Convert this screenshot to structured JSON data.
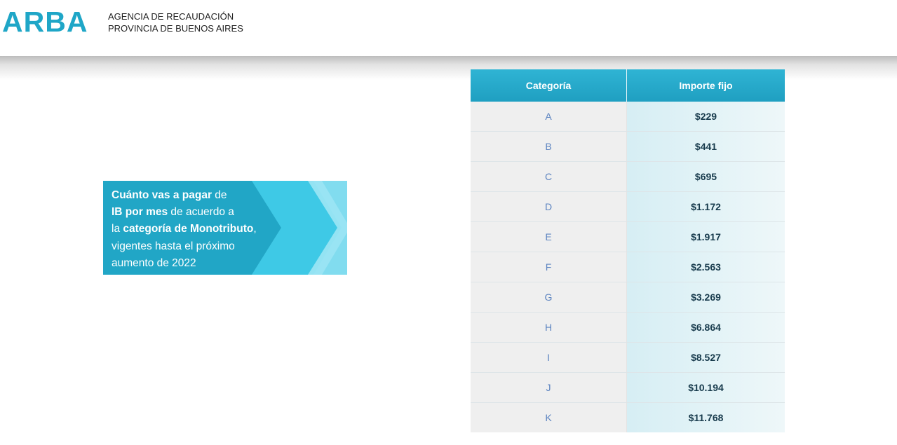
{
  "header": {
    "logo_text": "ARBA",
    "agency_line1": "AGENCIA DE RECAUDACIÓN",
    "agency_line2": "PROVINCIA DE BUENOS AIRES"
  },
  "banner": {
    "p1_bold": "Cuánto vas a pagar",
    "p1_rest": " de",
    "p2_bold": "IB por mes",
    "p2_rest": " de acuerdo a",
    "p3_start": "la ",
    "p3_bold": "categoría de Monotributo",
    "p3_rest": ",",
    "p4": "vigentes hasta el próximo",
    "p5": "aumento de 2022"
  },
  "table": {
    "headers": [
      "Categoría",
      "Importe fijo"
    ],
    "rows": [
      {
        "categoria": "A",
        "importe": "$229"
      },
      {
        "categoria": "B",
        "importe": "$441"
      },
      {
        "categoria": "C",
        "importe": "$695"
      },
      {
        "categoria": "D",
        "importe": "$1.172"
      },
      {
        "categoria": "E",
        "importe": "$1.917"
      },
      {
        "categoria": "F",
        "importe": "$2.563"
      },
      {
        "categoria": "G",
        "importe": "$3.269"
      },
      {
        "categoria": "H",
        "importe": "$6.864"
      },
      {
        "categoria": "I",
        "importe": "$8.527"
      },
      {
        "categoria": "J",
        "importe": "$10.194"
      },
      {
        "categoria": "K",
        "importe": "$11.768"
      }
    ]
  },
  "colors": {
    "brand": "#1fa6c7",
    "banner_dark": "#21a6c6",
    "banner_mid": "#3ec9e6",
    "banner_light": "#62d3ec",
    "table_header": "#2aaed0",
    "category_text": "#5b83c0",
    "amount_text": "#173a4c"
  }
}
